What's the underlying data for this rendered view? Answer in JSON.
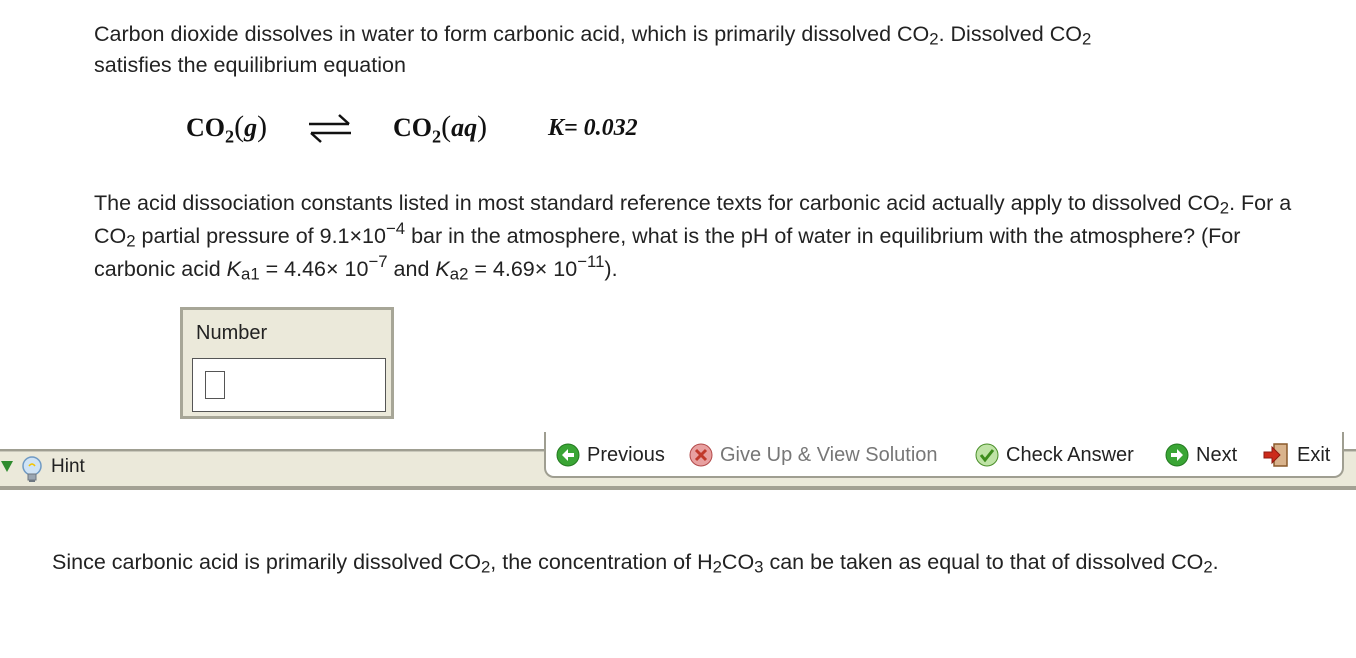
{
  "question": {
    "line1_a": "Carbon dioxide dissolves in water to form carbonic acid, which is primarily dissolved CO",
    "line1_b": ".  Dissolved CO",
    "line1_c": "satisfies the equilibrium equation",
    "sub2": "2",
    "p2_a": "The acid dissociation constants listed in most standard reference texts for carbonic acid actually apply to dissolved CO",
    "p2_b": ".  For a CO",
    "p2_c": " partial pressure of 9.1×10",
    "p2_exp1": "−4",
    "p2_d": " bar in the atmosphere, what is the pH of water in equilibrium with the atmosphere? (For carbonic acid ",
    "ka": "K",
    "a1": "a1",
    "p2_e": " = 4.46× 10",
    "p2_exp2": "−7",
    "p2_f": " and ",
    "a2": "a2",
    "p2_g": " = 4.69× 10",
    "p2_exp3": "−11",
    "p2_h": ")."
  },
  "equation": {
    "left_co": "CO",
    "left_phase": "g",
    "right_co": "CO",
    "right_phase": "aq",
    "sub": "2",
    "k_text": "K= 0.032"
  },
  "answer": {
    "label": "Number",
    "value": ""
  },
  "hint": {
    "label": "Hint"
  },
  "toolbar": {
    "previous": "Previous",
    "give_up": "Give Up & View Solution",
    "check": "Check Answer",
    "next": "Next",
    "exit": "Exit"
  },
  "hint_text": {
    "a": "Since carbonic acid is primarily dissolved CO",
    "b": ", the concentration of H",
    "c": "CO",
    "d": " can be taken as equal to that of dissolved CO",
    "e": ".",
    "sub2": "2",
    "sub3": "3"
  },
  "colors": {
    "previous_green": "#3aa535",
    "giveup_red": "#d84a3a",
    "check_green": "#5fb53a",
    "exit_red": "#cc2a1a",
    "panel_bg": "#ebe9da",
    "hint_arrow": "#2e8b2e"
  },
  "icons": [
    "previous-arrow-icon",
    "give-up-x-icon",
    "check-icon",
    "next-arrow-icon",
    "exit-door-icon",
    "hint-lightbulb-icon",
    "hint-expand-triangle-icon"
  ]
}
